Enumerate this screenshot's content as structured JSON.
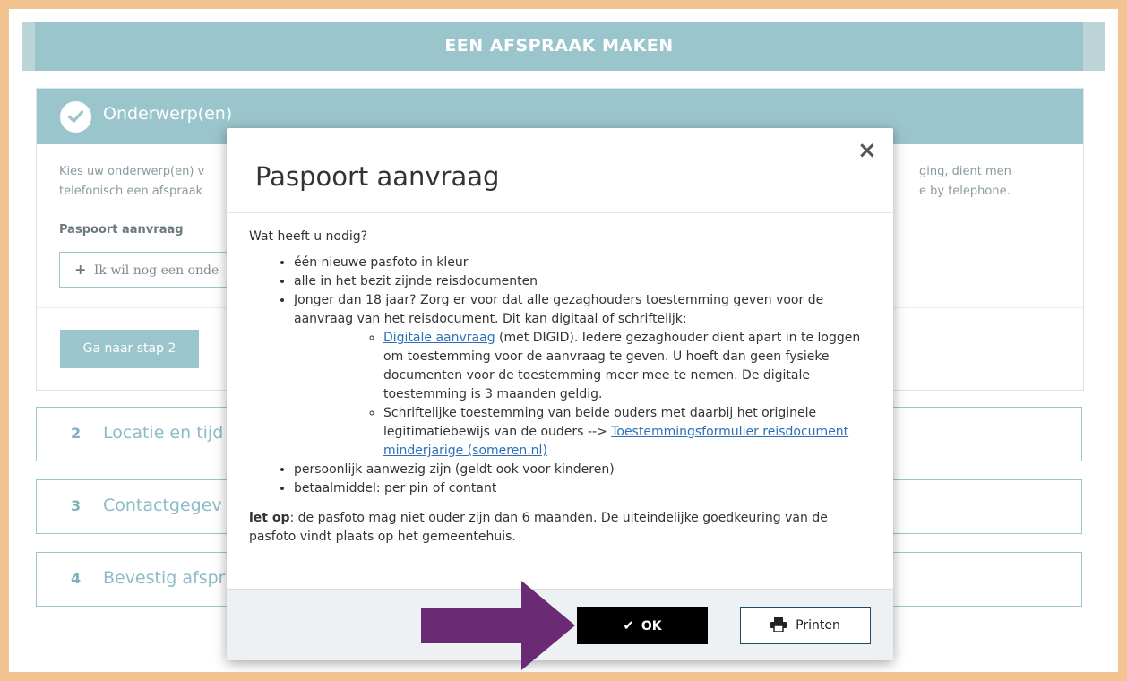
{
  "header": {
    "title": "EEN AFSPRAAK MAKEN"
  },
  "step1": {
    "title": "Onderwerp(en)",
    "text_line1": "Kies uw onderwerp(en) v",
    "text_line2": "telefonisch een afspraak",
    "text_right1": "ging, dient men",
    "text_right2": "e by telephone.",
    "selected_subject": "Paspoort aanvraag",
    "add_subject_label": "Ik wil nog een onde",
    "next_button": "Ga naar stap 2"
  },
  "steps": [
    {
      "number": "2",
      "label": "Locatie en tijd"
    },
    {
      "number": "3",
      "label": "Contactgegev"
    },
    {
      "number": "4",
      "label": "Bevestig afspr"
    }
  ],
  "modal": {
    "title": "Paspoort aanvraag",
    "close_symbol": "×",
    "intro": "Wat heeft u nodig?",
    "item1": "één nieuwe pasfoto in kleur",
    "item2": "alle in het bezit zijnde reisdocumenten",
    "item3": "Jonger dan 18 jaar? Zorg er voor dat alle gezaghouders toestemming geven voor de aanvraag van het reisdocument. Dit kan digitaal of schriftelijk:",
    "sub1_link": "Digitale aanvraag",
    "sub1_text": " (met DIGID). Iedere gezaghouder dient apart in te loggen om toestemming voor de aanvraag te geven. U hoeft dan geen fysieke documenten voor de toestemming meer mee te nemen. De digitale toestemming is 3 maanden geldig.",
    "sub2_text": "Schriftelijke toestemming van beide ouders met daarbij het originele legitimatiebewijs van de ouders --> ",
    "sub2_link": "Toestemmingsformulier reisdocument minderjarige (someren.nl)",
    "item4": "persoonlijk aanwezig zijn (geldt ook voor kinderen)",
    "item5": "betaalmiddel: per pin of contant",
    "note_bold": "let op",
    "note_text": ": de pasfoto mag niet ouder zijn dan 6 maanden. De uiteindelijke goedkeuring van de pasfoto vindt plaats op het gemeentehuis.",
    "ok_button": "OK",
    "print_button": "Printen"
  },
  "colors": {
    "accent": "#9bc5cd",
    "border_frame": "#f3c48f",
    "arrow": "#6b2a74",
    "link": "#2b6fb8"
  }
}
